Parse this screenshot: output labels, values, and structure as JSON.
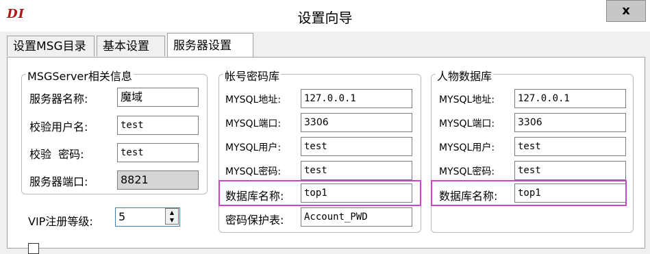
{
  "window": {
    "app_icon_text": "DI",
    "title": "设置向导",
    "close_label": "x"
  },
  "tabs": [
    {
      "label": "设置MSG目录"
    },
    {
      "label": "基本设置"
    },
    {
      "label": "服务器设置"
    }
  ],
  "msgserver": {
    "title": "MSGServer相关信息",
    "server_name_label": "服务器名称:",
    "server_name_value": "魔域",
    "verify_user_label": "校验用户名:",
    "verify_user_value": "test",
    "verify_pwd_label": "校验  密码:",
    "verify_pwd_value": "test",
    "server_port_label": "服务器端口:",
    "server_port_value": "8821"
  },
  "vip": {
    "label": "VIP注册等级:",
    "value": "5"
  },
  "account_db": {
    "title": "帐号密码库",
    "mysql_addr_label": "MYSQL地址:",
    "mysql_addr_value": "127.0.0.1",
    "mysql_port_label": "MYSQL端口:",
    "mysql_port_value": "3306",
    "mysql_user_label": "MYSQL用户:",
    "mysql_user_value": "test",
    "mysql_pwd_label": "MYSQL密码:",
    "mysql_pwd_value": "test",
    "db_name_label": "数据库名称:",
    "db_name_value": "top1",
    "pwd_table_label": "密码保护表:",
    "pwd_table_value": "Account_PWD"
  },
  "char_db": {
    "title": "人物数据库",
    "mysql_addr_label": "MYSQL地址:",
    "mysql_addr_value": "127.0.0.1",
    "mysql_port_label": "MYSQL端口:",
    "mysql_port_value": "3306",
    "mysql_user_label": "MYSQL用户:",
    "mysql_user_value": "test",
    "mysql_pwd_label": "MYSQL密码:",
    "mysql_pwd_value": "test",
    "db_name_label": "数据库名称:",
    "db_name_value": "top1"
  },
  "colors": {
    "highlight": "#cc44cc",
    "app_icon": "#b01818",
    "warning_text": "#e02020"
  }
}
